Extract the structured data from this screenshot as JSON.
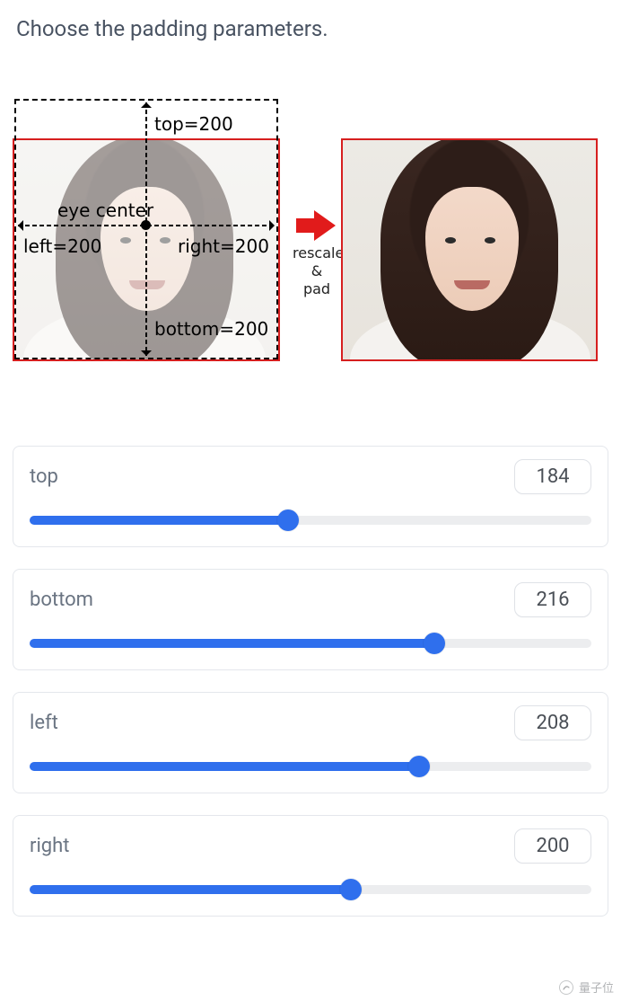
{
  "title": "Choose the padding parameters.",
  "diagram": {
    "labels": {
      "top": "top=200",
      "bottom": "bottom=200",
      "left": "left=200",
      "right": "right=200",
      "eye_center": "eye center"
    },
    "arrow_caption": "rescale\n&\npad"
  },
  "sliders": [
    {
      "key": "top",
      "label": "top",
      "value": 184,
      "min": 0,
      "max": 400
    },
    {
      "key": "bottom",
      "label": "bottom",
      "value": 216,
      "min": 0,
      "max": 300
    },
    {
      "key": "left",
      "label": "left",
      "value": 208,
      "min": 0,
      "max": 300
    },
    {
      "key": "right",
      "label": "right",
      "value": 200,
      "min": 0,
      "max": 350
    }
  ],
  "watermark": {
    "text": "量子位"
  }
}
